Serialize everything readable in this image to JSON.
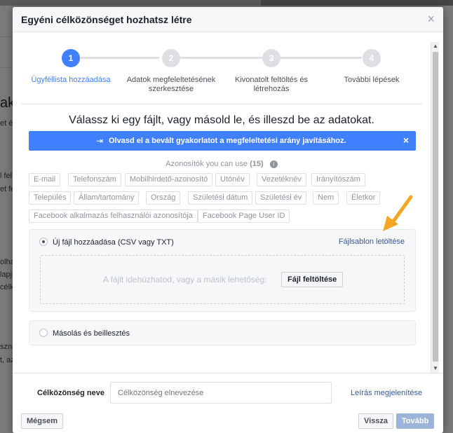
{
  "modal": {
    "title": "Egyéni célközönséget hozhatsz létre",
    "close_glyph": "×"
  },
  "steps": [
    {
      "number": "1",
      "label": "Ügyféllista hozzáadása",
      "active": true
    },
    {
      "number": "2",
      "label_line1": "Adatok megfeleltetésének",
      "label_line2": "szerkesztése",
      "active": false
    },
    {
      "number": "3",
      "label_line1": "Kivonatolt feltöltés és",
      "label_line2": "létrehozás",
      "active": false
    },
    {
      "number": "4",
      "label": "További lépések",
      "active": false
    }
  ],
  "heading": "Válassz ki egy fájlt, vagy másold le, és illeszd be az adatokat.",
  "banner": {
    "text": "Olvasd el a bevált gyakorlatot a megfeleltetési arány javításához.",
    "close_glyph": "×",
    "icon": "login-arrow-icon"
  },
  "identifiers": {
    "title_prefix": "Azonosítók you can use",
    "count": "(15)",
    "help_glyph": "i",
    "chips": [
      "E-mail",
      "Telefonszám",
      "Mobilhirdető-azonosító",
      "Utónév",
      "Vezetéknév",
      "Irányítószám",
      "Település",
      "Állam/tartomány",
      "Ország",
      "Születési dátum",
      "Születési év",
      "Nem",
      "Életkor",
      "Facebook alkalmazás felhasználói azonosítója",
      "Facebook Page User ID"
    ]
  },
  "upload_option": {
    "label": "Új fájl hozzáadása (CSV vagy TXT)",
    "template_link": "Fájlsablon letöltése",
    "drop_text": "A fájlt idehúzhatod, vagy a másik lehetőség:",
    "upload_button": "Fájl feltöltése",
    "selected": true
  },
  "paste_option": {
    "label": "Másolás és beillesztés",
    "selected": false
  },
  "footer": {
    "audience_label": "Célközönség neve",
    "audience_placeholder": "Célközönség elnevezése",
    "description_link": "Leírás megjelenítése",
    "cancel": "Mégsem",
    "back": "Vissza",
    "next": "Tovább"
  },
  "background": {
    "fragments": [
      "ak",
      "et é",
      "l fel",
      "et fe",
      "olhat",
      "lapjá",
      "célkö",
      "szna",
      "t, az"
    ]
  },
  "colors": {
    "accent": "#4080ff",
    "link": "#365899",
    "arrow": "#f5a623",
    "disabled_primary": "#9cb4d8"
  }
}
